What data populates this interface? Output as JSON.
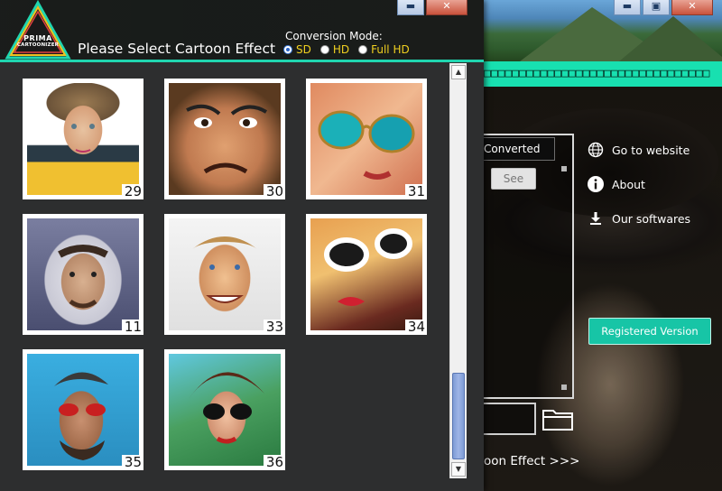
{
  "dialog": {
    "logo": {
      "line1": "PRIMA",
      "line2": "CARTOONIZER"
    },
    "title": "Please Select Cartoon Effect",
    "conversion_mode": {
      "label": "Conversion Mode:",
      "options": [
        "SD",
        "HD",
        "Full HD"
      ],
      "selected": "SD"
    },
    "titlebar": {
      "minimize": "▬",
      "close": "✕"
    },
    "effects": [
      {
        "number": "29",
        "icon": "boy-portrait"
      },
      {
        "number": "30",
        "icon": "man-face-closeup"
      },
      {
        "number": "31",
        "icon": "woman-aviator-sunglasses"
      },
      {
        "number": "11",
        "icon": "man-hooded"
      },
      {
        "number": "33",
        "icon": "smiling-man"
      },
      {
        "number": "34",
        "icon": "woman-white-sunglasses"
      },
      {
        "number": "35",
        "icon": "man-red-glasses"
      },
      {
        "number": "36",
        "icon": "woman-sunglasses"
      }
    ],
    "scrollbar": {
      "up": "▲",
      "down": "▼",
      "position_fraction": 0.82
    }
  },
  "background_app": {
    "titlebar": {
      "minimize": "▬",
      "maximize": "▣",
      "close": "✕"
    },
    "banner_text": "□□□□□□□□□□□□□□□□□□□□□□□□□□□□□□□□",
    "converted_label": "Converted",
    "see_button": "See",
    "menu": [
      {
        "label": "Go to website",
        "icon": "globe-icon"
      },
      {
        "label": "About",
        "icon": "info-icon"
      },
      {
        "label": "Our softwares",
        "icon": "download-icon"
      }
    ],
    "registered_button": "Registered Version",
    "effect_link": "oon Effect >>>"
  },
  "colors": {
    "accent": "#20d6b0",
    "mode_text": "#f0d020",
    "register_button": "#17c5a6"
  }
}
